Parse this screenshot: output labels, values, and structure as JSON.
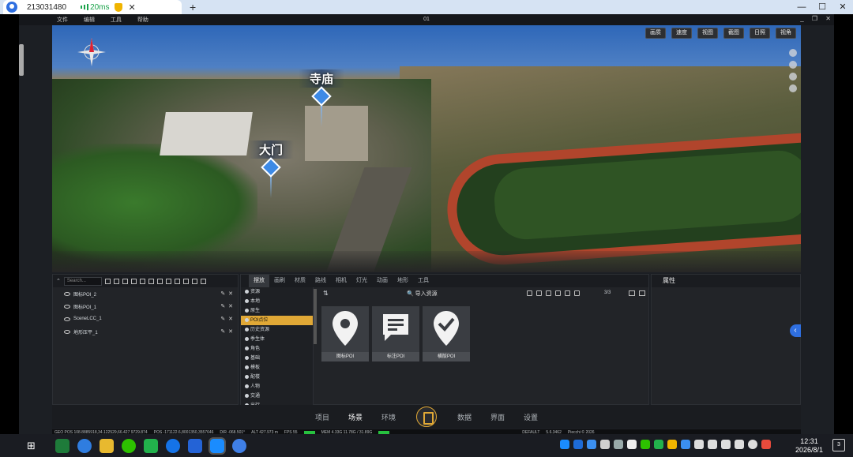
{
  "remote_tab": {
    "id_text": "213031480",
    "latency": "20ms",
    "close": "✕",
    "new_tab": "+"
  },
  "remote_window": {
    "min": "—",
    "max": "☐",
    "close": "✕"
  },
  "app": {
    "menu": [
      "文件",
      "编辑",
      "工具",
      "帮助"
    ],
    "title": "01",
    "window_buttons": [
      "_",
      "❐",
      "✕"
    ]
  },
  "viewport": {
    "toolbar": [
      "画质",
      "速度",
      "视图",
      "截图",
      "日照",
      "视角"
    ],
    "pois": [
      {
        "label": "寺庙"
      },
      {
        "label": "大门"
      }
    ]
  },
  "scene_panel": {
    "search_placeholder": "Search...",
    "items": [
      "图标POI_2",
      "图标POI_1",
      "SceneLCC_1",
      "地形压平_1"
    ]
  },
  "resource_panel": {
    "tabs": [
      "摆放",
      "画刷",
      "材质",
      "路线",
      "相机",
      "灯光",
      "动画",
      "地形",
      "工具"
    ],
    "categories": [
      "资源",
      "本地",
      "原生",
      "POI点位",
      "历史资源",
      "季生体",
      "角色",
      "基础",
      "模板",
      "配楼",
      "人物",
      "交通",
      "出行"
    ],
    "active_category": "POI点位",
    "import_label": "导入资源",
    "page": "3/3",
    "cards": [
      {
        "caption": "图标POI",
        "icon": "map-pin-icon"
      },
      {
        "caption": "标注POI",
        "icon": "message-icon"
      },
      {
        "caption": "横版POI",
        "icon": "check-icon"
      }
    ]
  },
  "properties_panel": {
    "title": "属性"
  },
  "bottom_nav": {
    "items": [
      "项目",
      "场景",
      "环境",
      "数据",
      "界面",
      "设置"
    ],
    "active": "场景"
  },
  "status": {
    "geo_pos": "GEO POS 108.8885918,34.122529,66.427 9729.874",
    "pos": "POS -171122.6,8001350,3557646",
    "dir": "DIR -068.501°",
    "alt": "ALT 427.973 m",
    "fps": "FPS 55",
    "mem": "MEM 4.33G 11.78G / 31.89G",
    "mode": "DEFAULT",
    "version": "5.6.3462",
    "copyright": "Piecchi © 2026"
  },
  "taskbar": {
    "time": "12:31",
    "date": "2026/8/1",
    "notifications": "3",
    "start_glyph": "⊞"
  },
  "colors": {
    "accent": "#e0a836",
    "poi_blue": "#3d8ae6",
    "status_green": "#27c13f"
  }
}
